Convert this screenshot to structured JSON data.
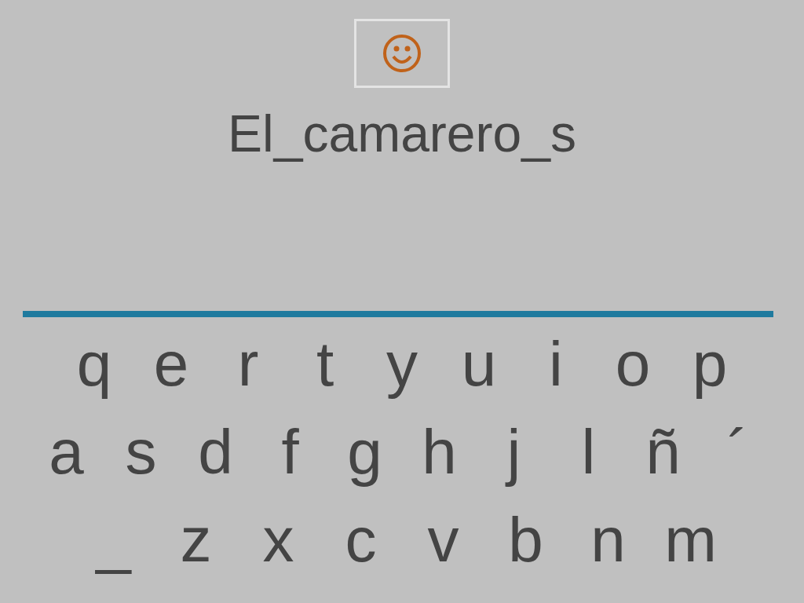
{
  "word": "El_camarero_s",
  "keyboard": {
    "rows": [
      [
        "q",
        "e",
        "r",
        "t",
        "y",
        "u",
        "i",
        "o",
        "p"
      ],
      [
        "a",
        "s",
        "d",
        "f",
        "g",
        "h",
        "j",
        "l",
        "ñ",
        "´"
      ],
      [
        "_",
        "z",
        "x",
        "c",
        "v",
        "b",
        "n",
        "m"
      ]
    ]
  }
}
